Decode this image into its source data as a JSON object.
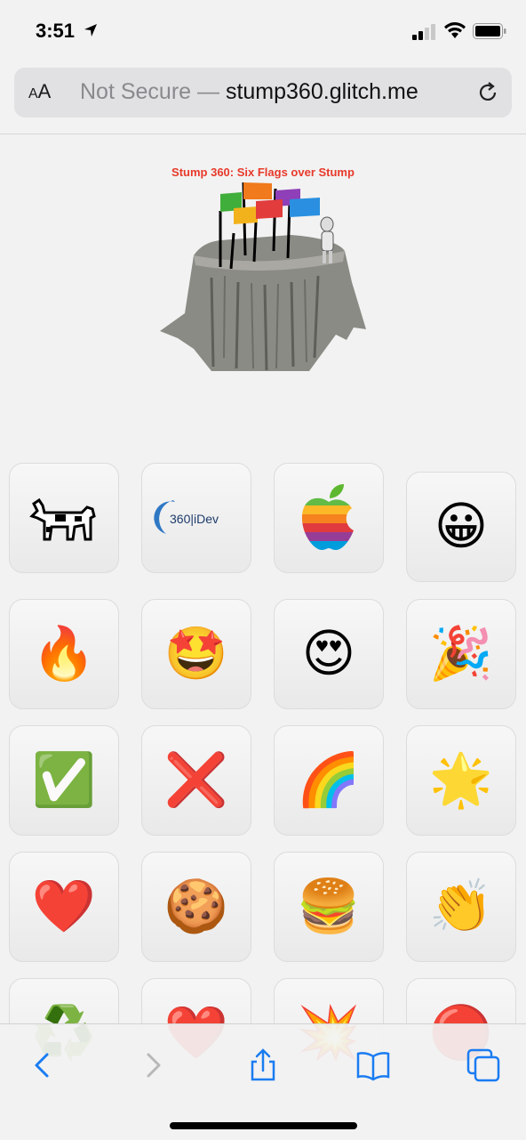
{
  "status": {
    "time": "3:51"
  },
  "browser": {
    "aa_label_small": "A",
    "aa_label_big": "A",
    "not_secure": "Not Secure — ",
    "domain": "stump360.glitch.me"
  },
  "hero": {
    "title": "Stump 360: Six Flags over Stump"
  },
  "tiles": [
    {
      "name": "dogcow",
      "emoji": ""
    },
    {
      "name": "360idev-logo",
      "emoji": "",
      "logo_text": "360|iDev"
    },
    {
      "name": "rainbow-apple-logo",
      "emoji": ""
    },
    {
      "name": "grinning-face",
      "emoji": "😀"
    },
    {
      "name": "fire",
      "emoji": "🔥"
    },
    {
      "name": "star-struck",
      "emoji": "🤩"
    },
    {
      "name": "heart-eyes",
      "emoji": "😍"
    },
    {
      "name": "party-popper",
      "emoji": "🎉"
    },
    {
      "name": "check-mark",
      "emoji": "✅"
    },
    {
      "name": "cross-mark",
      "emoji": "❌"
    },
    {
      "name": "rainbow",
      "emoji": "🌈"
    },
    {
      "name": "glowing-star",
      "emoji": "🌟"
    },
    {
      "name": "red-heart",
      "emoji": "❤️"
    },
    {
      "name": "cookie",
      "emoji": "🍪"
    },
    {
      "name": "hamburger",
      "emoji": "🍔"
    },
    {
      "name": "clapping-hands",
      "emoji": "👏"
    },
    {
      "name": "recycle",
      "emoji": "♻️"
    },
    {
      "name": "heart",
      "emoji": "❤️"
    },
    {
      "name": "collision",
      "emoji": "💥"
    },
    {
      "name": "red-circle",
      "emoji": "🔴"
    }
  ],
  "colors": {
    "accent": "#1a7cf2",
    "hero_title": "#e8392a"
  }
}
